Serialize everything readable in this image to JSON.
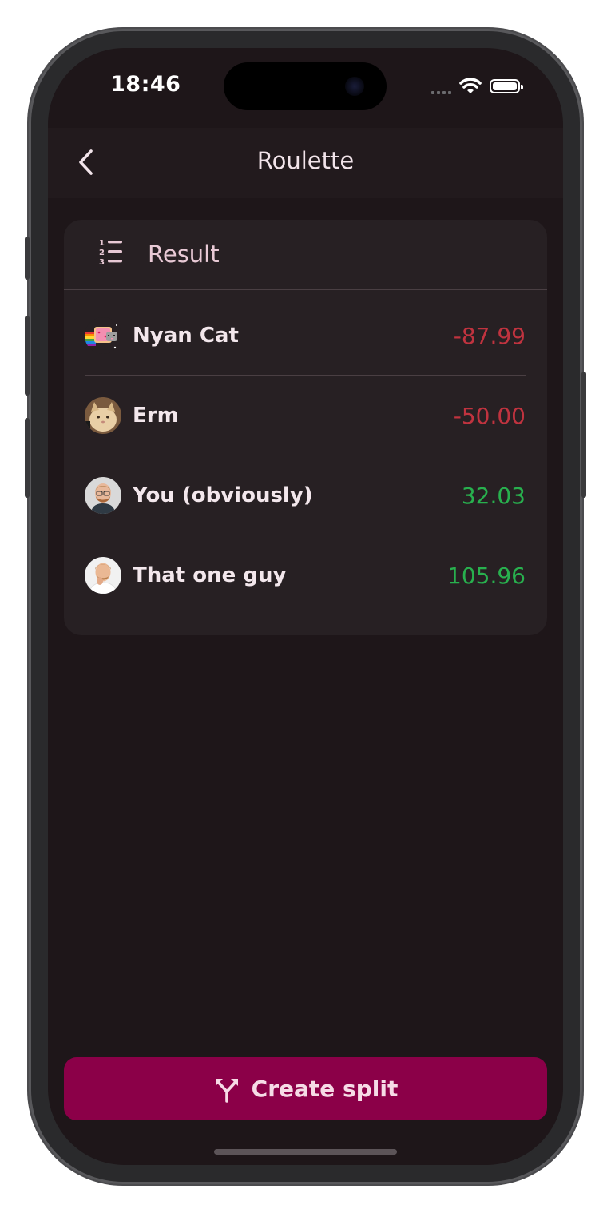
{
  "status_bar": {
    "time": "18:46",
    "icons": [
      "cellular-signal-icon",
      "wifi-icon",
      "battery-icon"
    ]
  },
  "nav": {
    "back_icon": "chevron-left-icon",
    "title": "Roulette"
  },
  "result_card": {
    "icon": "numbered-list-icon",
    "title": "Result",
    "rows": [
      {
        "name": "Nyan Cat",
        "amount": "-87.99",
        "avatar": "nyan-cat-avatar",
        "sign": "negative"
      },
      {
        "name": "Erm",
        "amount": "-50.00",
        "avatar": "cat-avatar",
        "sign": "negative"
      },
      {
        "name": "You (obviously)",
        "amount": "32.03",
        "avatar": "bearded-man-avatar",
        "sign": "positive"
      },
      {
        "name": "That one guy",
        "amount": "105.96",
        "avatar": "thinking-man-avatar",
        "sign": "positive"
      }
    ]
  },
  "actions": {
    "create_split_icon": "split-arrows-icon",
    "create_split_label": "Create split"
  },
  "colors": {
    "background": "#1e1619",
    "card": "#272023",
    "accent": "#8b0048",
    "negative": "#c0333f",
    "positive": "#28b04e",
    "title_text": "#e8c9d5"
  }
}
